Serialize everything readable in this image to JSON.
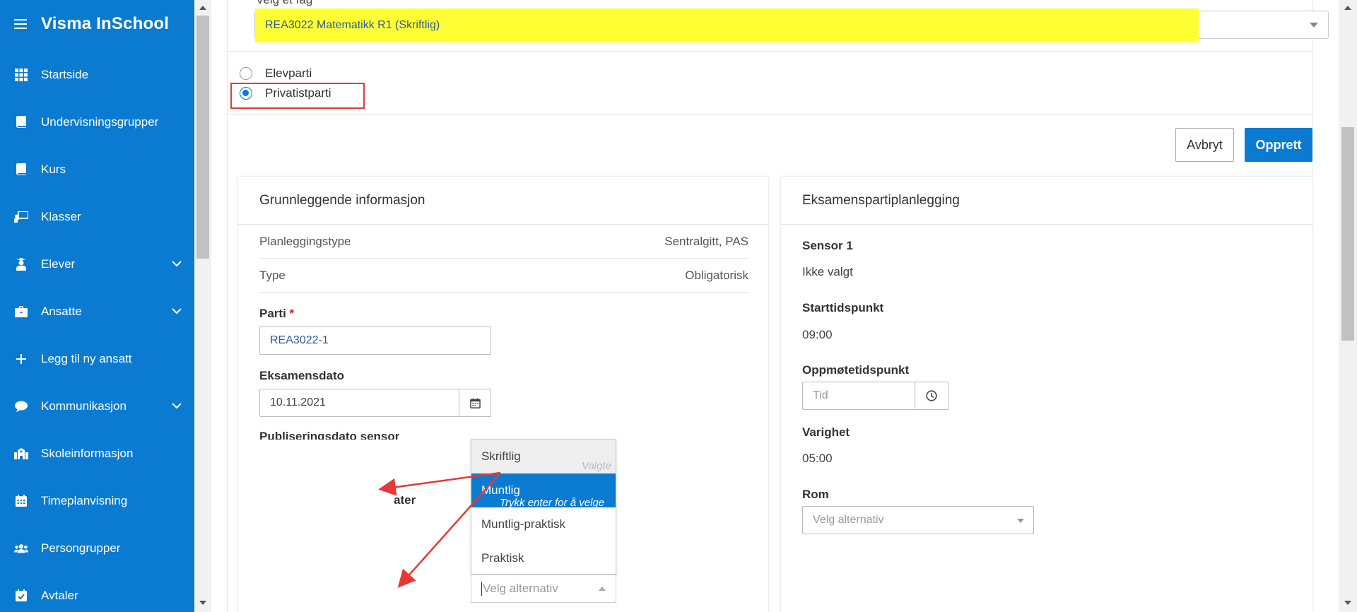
{
  "app": {
    "title": "Visma InSchool"
  },
  "sidebar": {
    "items": [
      {
        "label": "Startside",
        "icon": "grid-icon",
        "expandable": false
      },
      {
        "label": "Undervisningsgrupper",
        "icon": "book-icon",
        "expandable": false
      },
      {
        "label": "Kurs",
        "icon": "book-icon",
        "expandable": false
      },
      {
        "label": "Klasser",
        "icon": "teacher-board-icon",
        "expandable": false
      },
      {
        "label": "Elever",
        "icon": "student-icon",
        "expandable": true
      },
      {
        "label": "Ansatte",
        "icon": "briefcase-icon",
        "expandable": true
      },
      {
        "label": "Legg til ny ansatt",
        "icon": "plus-icon",
        "expandable": false
      },
      {
        "label": "Kommunikasjon",
        "icon": "chat-bubble-icon",
        "expandable": true
      },
      {
        "label": "Skoleinformasjon",
        "icon": "school-icon",
        "expandable": false
      },
      {
        "label": "Timeplanvisning",
        "icon": "calendar-icon",
        "expandable": false
      },
      {
        "label": "Persongrupper",
        "icon": "people-icon",
        "expandable": false
      },
      {
        "label": "Avtaler",
        "icon": "calendar-check-icon",
        "expandable": false
      }
    ]
  },
  "subject": {
    "label": "Velg et fag",
    "value": "REA3022 Matematikk R1 (Skriftlig)"
  },
  "party_type": {
    "options": [
      "Elevparti",
      "Privatistparti"
    ],
    "selected": "Privatistparti"
  },
  "actions": {
    "cancel": "Avbryt",
    "create": "Opprett"
  },
  "basic_info": {
    "title": "Grunnleggende informasjon",
    "rows": [
      {
        "label": "Planleggingstype",
        "value": "Sentralgitt, PAS"
      },
      {
        "label": "Type",
        "value": "Obligatorisk"
      }
    ],
    "parti": {
      "label": "Parti",
      "required_mark": "*",
      "value": "REA3022-1"
    },
    "exam_date": {
      "label": "Eksamensdato",
      "value": "10.11.2021"
    },
    "publish_label": "Publiseringsdato sensor",
    "hidden_label_fragment": "ater",
    "dropdown": {
      "options": [
        "Skriftlig",
        "Muntlig",
        "Muntlig-praktisk",
        "Praktisk"
      ],
      "selected_hint": "Valgte",
      "enter_hint": "Trykk enter for å velge",
      "placeholder": "Velg alternativ"
    }
  },
  "exam_planning": {
    "title": "Eksamenspartiplanlegging",
    "sensor": {
      "label": "Sensor 1",
      "value": "Ikke valgt"
    },
    "start": {
      "label": "Starttidspunkt",
      "value": "09:00"
    },
    "attendance": {
      "label": "Oppmøtetidspunkt",
      "placeholder": "Tid"
    },
    "duration": {
      "label": "Varighet",
      "value": "05:00"
    },
    "room": {
      "label": "Rom",
      "placeholder": "Velg alternativ"
    }
  },
  "colors": {
    "sidebar": "#0a7bd1",
    "accent": "#0a7bd1",
    "highlight": "#ffff33",
    "annotation": "#e53935"
  }
}
